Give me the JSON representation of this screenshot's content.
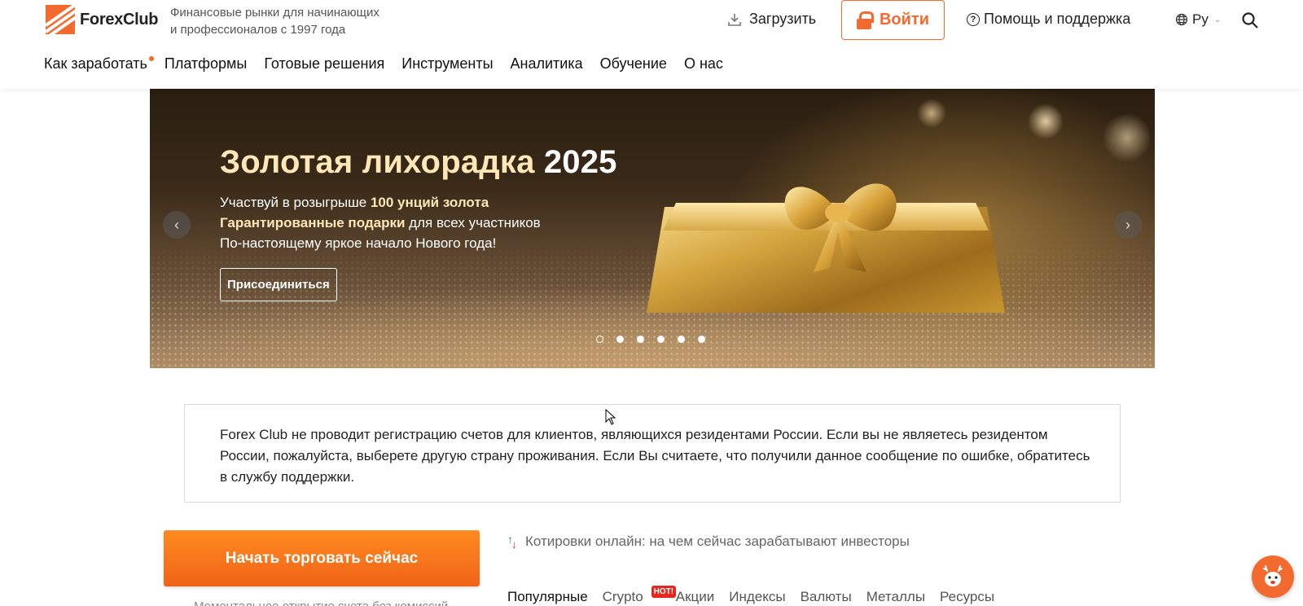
{
  "brand": {
    "logo_text": "ForexClub",
    "tagline_line1": "Финансовые рынки для начинающих",
    "tagline_line2": "и профессионалов с 1997 года",
    "accent": "#f26a2e"
  },
  "header": {
    "download_label": "Загрузить",
    "login_label": "Войти",
    "help_label": "Помощь и поддержка",
    "lang_label": "Ру"
  },
  "nav": {
    "items": [
      {
        "label": "Как заработать",
        "has_dot": true
      },
      {
        "label": "Платформы"
      },
      {
        "label": "Готовые решения"
      },
      {
        "label": "Инструменты"
      },
      {
        "label": "Аналитика"
      },
      {
        "label": "Обучение"
      },
      {
        "label": "О нас"
      }
    ]
  },
  "banner": {
    "title_main": "Золотая лихорадка ",
    "title_year": "2025",
    "line1_prefix": "Участвуй в розыгрыше ",
    "line1_bold": "100 унций золота",
    "line2_bold": "Гарантированные подарки",
    "line2_suffix": " для всех участников",
    "line3": "По-настоящему яркое начало Нового года!",
    "cta_label": "Присоединиться",
    "prev_icon": "‹",
    "next_icon": "›",
    "slide_count": 6,
    "active_slide": 1
  },
  "notice": {
    "text": "Forex Club не проводит регистрацию счетов для клиентов, являющихся резидентами России. Если вы не являетесь резидентом России, пожалуйста, выберете другую страну проживания. Если Вы считаете, что получили данное сообщение по ошибке, обратитесь в службу поддержки."
  },
  "cta": {
    "start_label": "Начать торговать сейчас",
    "sub_label": "Моментальное открытие счета без комиссий"
  },
  "quotes": {
    "heading": "Котировки онлайн: на чем сейчас зарабатывают инвесторы",
    "tabs": [
      {
        "label": "Популярные",
        "active": true
      },
      {
        "label": "Crypto",
        "badge": "HOT!"
      },
      {
        "label": "Акции"
      },
      {
        "label": "Индексы"
      },
      {
        "label": "Валюты"
      },
      {
        "label": "Металлы"
      },
      {
        "label": "Ресурсы"
      }
    ]
  }
}
